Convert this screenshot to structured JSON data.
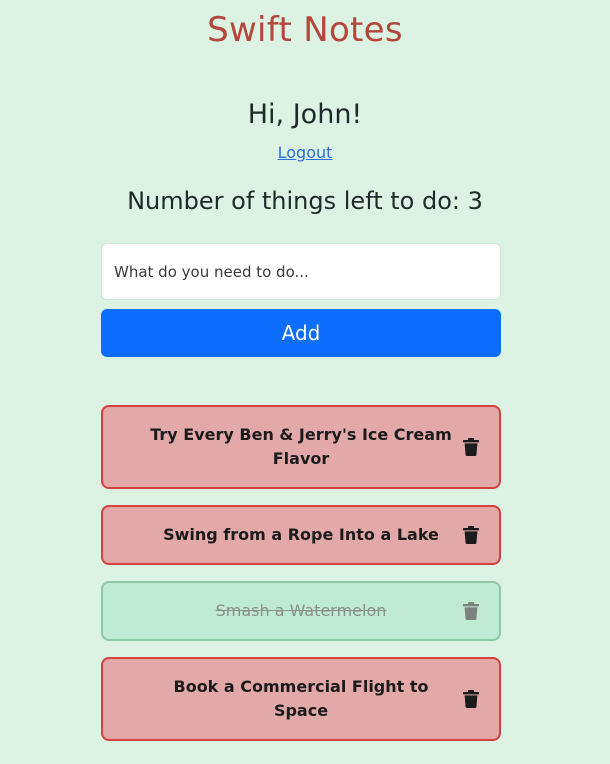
{
  "app": {
    "title": "Swift Notes"
  },
  "user": {
    "greeting": "Hi, John!",
    "logout_label": "Logout"
  },
  "summary": {
    "count_text": "Number of things left to do: 3"
  },
  "new_todo": {
    "placeholder": "What do you need to do...",
    "value": "",
    "add_label": "Add"
  },
  "todos": [
    {
      "text": "Try Every Ben & Jerry's Ice Cream Flavor",
      "completed": false
    },
    {
      "text": "Swing from a Rope Into a Lake",
      "completed": false
    },
    {
      "text": "Smash a Watermelon",
      "completed": true
    },
    {
      "text": "Book a Commercial Flight to Space",
      "completed": false
    }
  ],
  "icons": {
    "delete": "trash-icon"
  },
  "colors": {
    "background": "#dcf3e3",
    "title": "#b4463c",
    "primary_button": "#0d6efd",
    "pending_fill": "#e3a9a9",
    "pending_border": "#d64040",
    "done_fill": "#bfebd5",
    "done_border": "#8fc7a6",
    "link": "#2c6fdc"
  }
}
